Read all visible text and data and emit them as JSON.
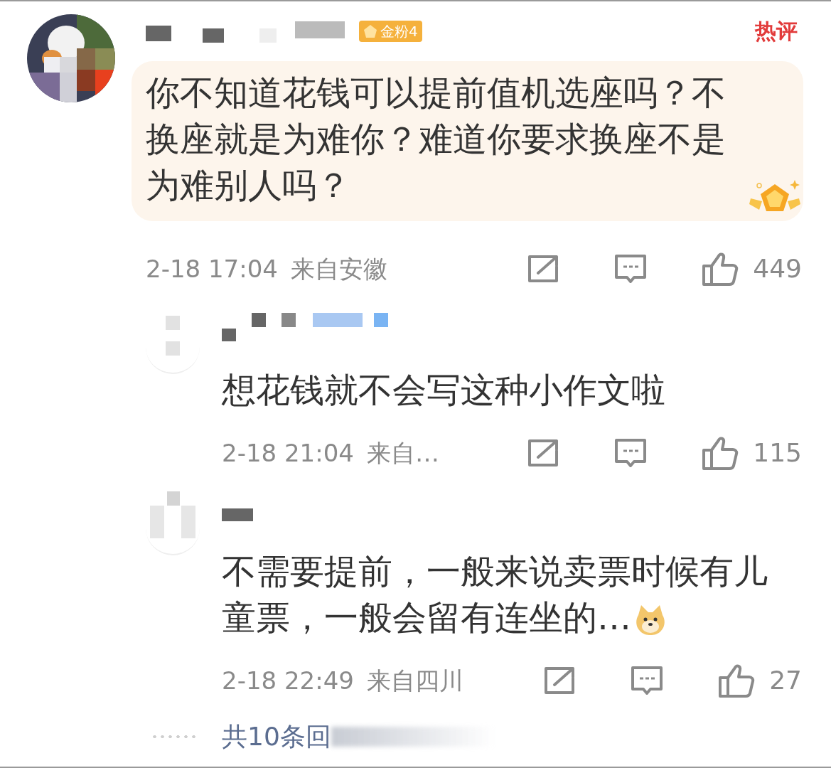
{
  "comment": {
    "author_badge": "金粉4",
    "hot_label": "热评",
    "text": "你不知道花钱可以提前值机选座吗？不换座就是为难你？难道你要求换座不是为难别人吗？",
    "time": "2-18 17:04",
    "location": "来自安徽",
    "likes": "449"
  },
  "replies": [
    {
      "text": "想花钱就不会写这种小作文啦",
      "time": "2-18 21:04",
      "location": "来自…",
      "likes": "115",
      "has_emoji": false
    },
    {
      "text": "不需要提前，一般来说卖票时候有儿童票，一般会留有连坐的…",
      "time": "2-18 22:49",
      "location": "来自四川",
      "likes": "27",
      "has_emoji": true
    }
  ],
  "more_replies": {
    "label": "共10条回"
  }
}
